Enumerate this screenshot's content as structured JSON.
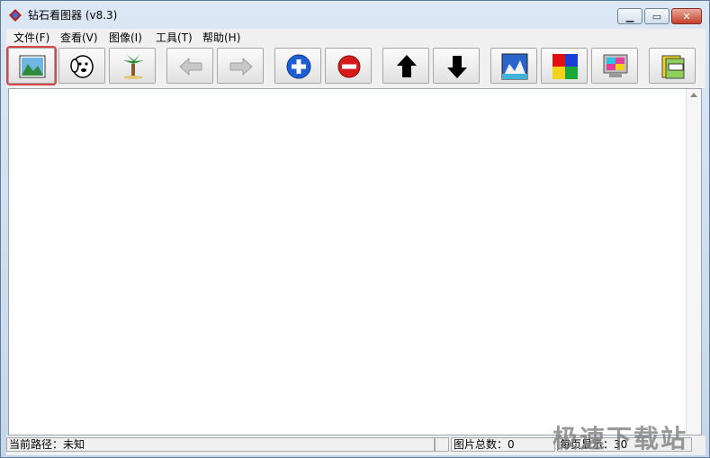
{
  "window": {
    "title": "钻石看图器 (v8.3)"
  },
  "menu": [
    {
      "label": "文件(F)"
    },
    {
      "label": "查看(V)"
    },
    {
      "label": "图像(I)"
    },
    {
      "label": "工具(T)"
    },
    {
      "label": "帮助(H)"
    }
  ],
  "toolbar": {
    "buttons": [
      {
        "icon": "open-image-icon"
      },
      {
        "icon": "dog-face-icon"
      },
      {
        "icon": "palm-tree-icon"
      },
      {
        "icon": "arrow-left-icon"
      },
      {
        "icon": "arrow-right-icon"
      },
      {
        "icon": "zoom-in-plus-icon"
      },
      {
        "icon": "zoom-out-minus-icon"
      },
      {
        "icon": "arrow-up-icon"
      },
      {
        "icon": "arrow-down-icon"
      },
      {
        "icon": "scene-image-icon"
      },
      {
        "icon": "color-squares-icon"
      },
      {
        "icon": "monitor-icon"
      },
      {
        "icon": "labels-icon"
      }
    ]
  },
  "status": {
    "path": "当前路径：未知",
    "total": "图片总数：0",
    "per_page": "每页显示：30"
  },
  "watermark": "极速下载站",
  "colors": {
    "zoom_in": "#1a5fd6",
    "zoom_out": "#d61a1a",
    "active_outline": "#d94444"
  }
}
